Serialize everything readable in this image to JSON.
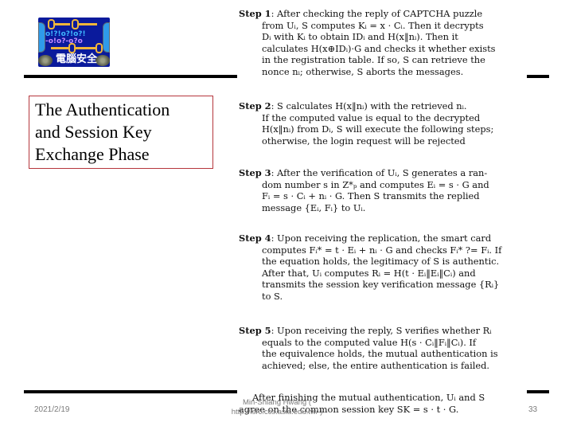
{
  "logo": {
    "text": "電腦安全",
    "glyph_row1": "o!?!o?!o?!",
    "glyph_row2": "-o!o?-o?o"
  },
  "title": "The Authentication\nand Session Key\nExchange Phase",
  "steps": [
    {
      "label": "Step 1",
      "lines": [
        ": After checking the reply of CAPTCHA puzzle",
        "from Uᵢ, S computes Kᵢ = x · Cᵢ. Then it decrypts",
        "Dᵢ with Kᵢ to obtain IDᵢ and H(x‖nᵢ). Then it",
        "calculates H(x⊕IDᵢ)·G and checks it whether exists",
        "in the registration table. If so, S can retrieve the",
        "nonce nᵢ; otherwise, S aborts the messages."
      ]
    },
    {
      "label": "Step 2",
      "lines": [
        ": S calculates H(x‖nᵢ) with the retrieved nᵢ.",
        "If the computed value is equal to the decrypted",
        "H(x‖nᵢ) from Dᵢ, S will execute the following steps;",
        "otherwise, the login request will be rejected"
      ]
    },
    {
      "label": "Step 3",
      "lines": [
        ": After the verification of Uᵢ, S generates a ran-",
        "dom number s in Z*ₚ and computes Eᵢ = s · G and",
        "Fᵢ = s · Cᵢ + nᵢ · G. Then S transmits the replied",
        "message {Eᵢ, Fᵢ} to Uᵢ."
      ]
    },
    {
      "label": "Step 4",
      "lines": [
        ": Upon receiving the replication, the smart card",
        "computes Fᵢ* = t · Eᵢ + nᵢ · G and checks Fᵢ* ?= Fᵢ. If",
        "the equation holds, the legitimacy of S is authentic.",
        "After that, Uᵢ computes Rᵢ = H(t · Eᵢ‖Eᵢ‖Cᵢ) and",
        "transmits the session key verification message {Rᵢ}",
        "to S."
      ]
    },
    {
      "label": "Step 5",
      "lines": [
        ": Upon receiving the reply, S verifies whether Rᵢ",
        "equals to the computed value H(s · Cᵢ‖Fᵢ‖Cᵢ). If",
        "the equivalence holds, the mutual authentication is",
        "achieved; else, the entire authentication is failed."
      ]
    }
  ],
  "closing": {
    "lines": [
      "After finishing the mutual authentication, Uᵢ and S",
      "agree on the common session key SK = s · t · G."
    ]
  },
  "footer": {
    "date": "2021/2/19",
    "author_line1": "Min-Shiang Hwang (",
    "author_line2": "http://isrc.ccs.asia.edu.tw/ )",
    "page_number": "33"
  },
  "colors": {
    "title_border": "#b5363c",
    "footer_text": "#7b7b7b",
    "logo_background": "#0a1a9c",
    "logo_key": "#f0b63a"
  }
}
